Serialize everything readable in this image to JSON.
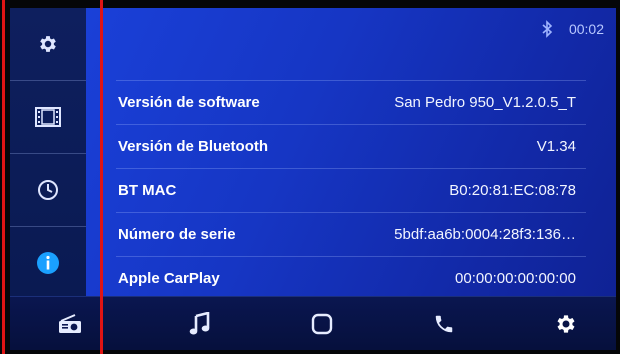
{
  "status": {
    "bluetooth_icon": "bluetooth-icon",
    "time": "00:02"
  },
  "sidebar": {
    "items": [
      {
        "icon": "gear-icon"
      },
      {
        "icon": "film-icon"
      },
      {
        "icon": "clock-icon"
      },
      {
        "icon": "info-icon",
        "active": true
      }
    ]
  },
  "info": {
    "rows": [
      {
        "label": "Versión de software",
        "value": "San Pedro 950_V1.2.0.5_T"
      },
      {
        "label": "Versión de Bluetooth",
        "value": "V1.34"
      },
      {
        "label": "BT MAC",
        "value": "B0:20:81:EC:08:78"
      },
      {
        "label": "Número de serie",
        "value": "5bdf:aa6b:0004:28f3:136…"
      },
      {
        "label": "Apple CarPlay",
        "value": "00:00:00:00:00:00"
      }
    ]
  },
  "bottombar": {
    "tabs": [
      {
        "icon": "radio-icon"
      },
      {
        "icon": "music-note-icon"
      },
      {
        "icon": "home-icon"
      },
      {
        "icon": "phone-icon"
      },
      {
        "icon": "settings-icon",
        "active": true
      }
    ]
  },
  "colors": {
    "accent": "#4d8cff",
    "info_active": "#1aa0ff",
    "annotation": "#e01414"
  }
}
